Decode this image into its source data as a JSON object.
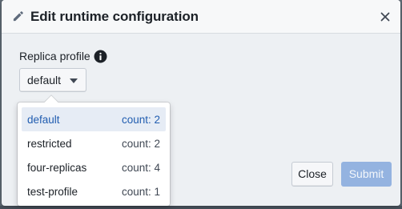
{
  "dialog": {
    "title": "Edit runtime configuration",
    "icon": "pencil-icon",
    "close_icon": "close-icon"
  },
  "field": {
    "label": "Replica profile",
    "info_icon": "info-icon",
    "selected_value": "default"
  },
  "dropdown": {
    "items": [
      {
        "name": "default",
        "count": "count: 2",
        "active": true
      },
      {
        "name": "restricted",
        "count": "count: 2",
        "active": false
      },
      {
        "name": "four-replicas",
        "count": "count: 4",
        "active": false
      },
      {
        "name": "test-profile",
        "count": "count: 1",
        "active": false
      }
    ]
  },
  "footer": {
    "close_label": "Close",
    "submit_label": "Submit",
    "submit_disabled": true
  },
  "colors": {
    "accent": "#215db0",
    "submit_disabled_bg": "#94b3e0",
    "active_item_bg": "#e6ecf5"
  }
}
